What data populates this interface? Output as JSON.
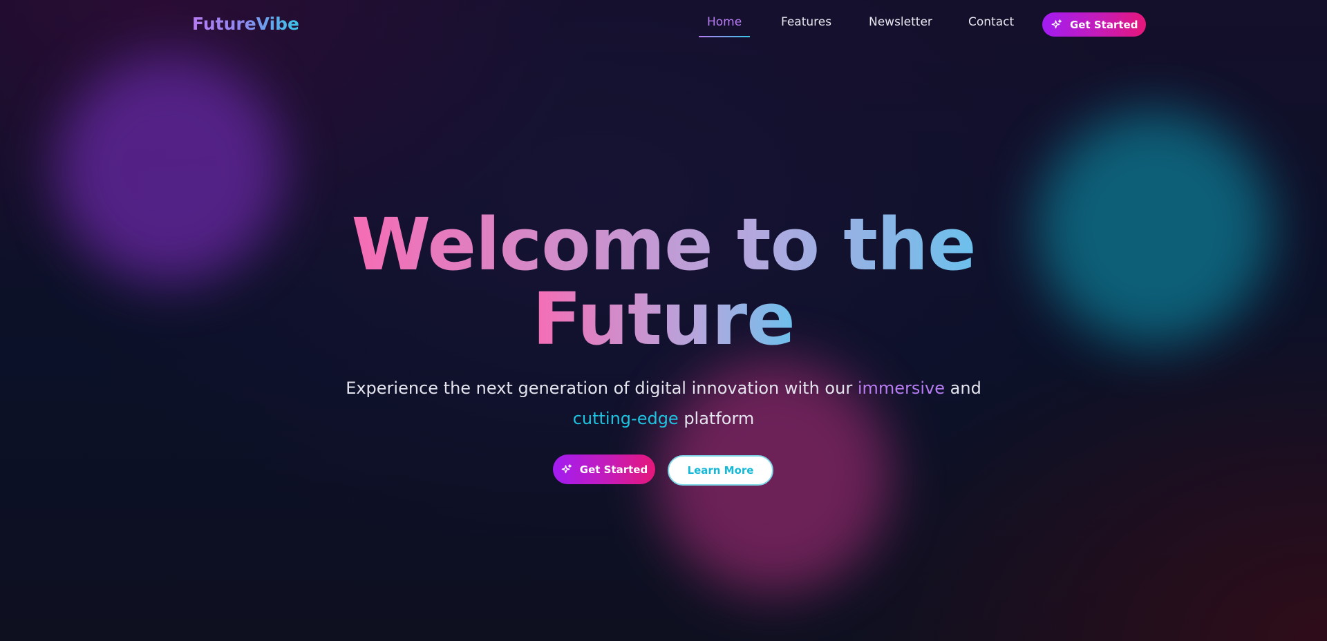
{
  "brand": {
    "name": "FutureVibe"
  },
  "nav": {
    "links": [
      {
        "label": "Home",
        "active": true
      },
      {
        "label": "Features"
      },
      {
        "label": "Newsletter"
      },
      {
        "label": "Contact"
      }
    ],
    "cta_label": "Get Started",
    "cta_icon": "sparkles-icon"
  },
  "hero": {
    "title_line1": "Welcome to the",
    "title_line2": "Future",
    "subtitle_part1": "Experience the next generation of digital innovation with our ",
    "subtitle_highlight1": "immersive",
    "subtitle_part2": " and ",
    "subtitle_highlight2": "cutting-edge",
    "subtitle_part3": " platform",
    "primary_cta": "Get Started",
    "secondary_cta": "Learn More"
  },
  "colors": {
    "accent_purple": "#b77bf2",
    "accent_cyan": "#1ec3df",
    "accent_pink": "#e6177a",
    "background": "#0b1128"
  }
}
